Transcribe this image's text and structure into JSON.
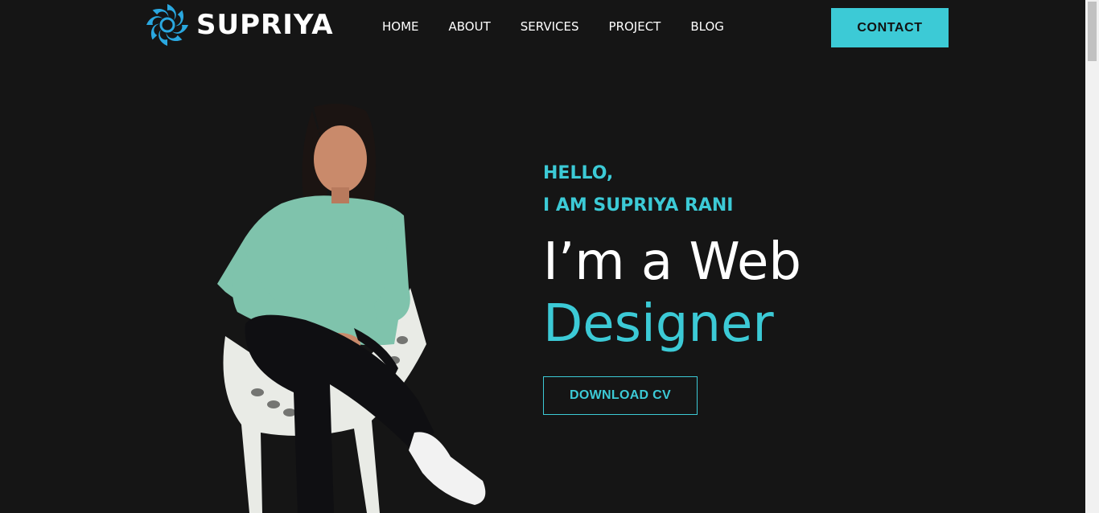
{
  "brand": {
    "name": "SUPRIYA",
    "logo_icon": "spiral-logo-icon",
    "accent": "#3ccad6"
  },
  "nav": {
    "items": [
      {
        "label": "HOME"
      },
      {
        "label": "ABOUT"
      },
      {
        "label": "SERVICES"
      },
      {
        "label": "PROJECT"
      },
      {
        "label": "BLOG"
      }
    ],
    "contact_label": "CONTACT"
  },
  "hero": {
    "greeting_line1": "HELLO,",
    "greeting_line2": "I AM SUPRIYA RANI",
    "title_line1": "I’m a Web",
    "title_line2": "Designer",
    "cta_label": "DOWNLOAD CV"
  },
  "colors": {
    "background": "#151515",
    "accent": "#3ccad6",
    "text": "#ffffff"
  }
}
